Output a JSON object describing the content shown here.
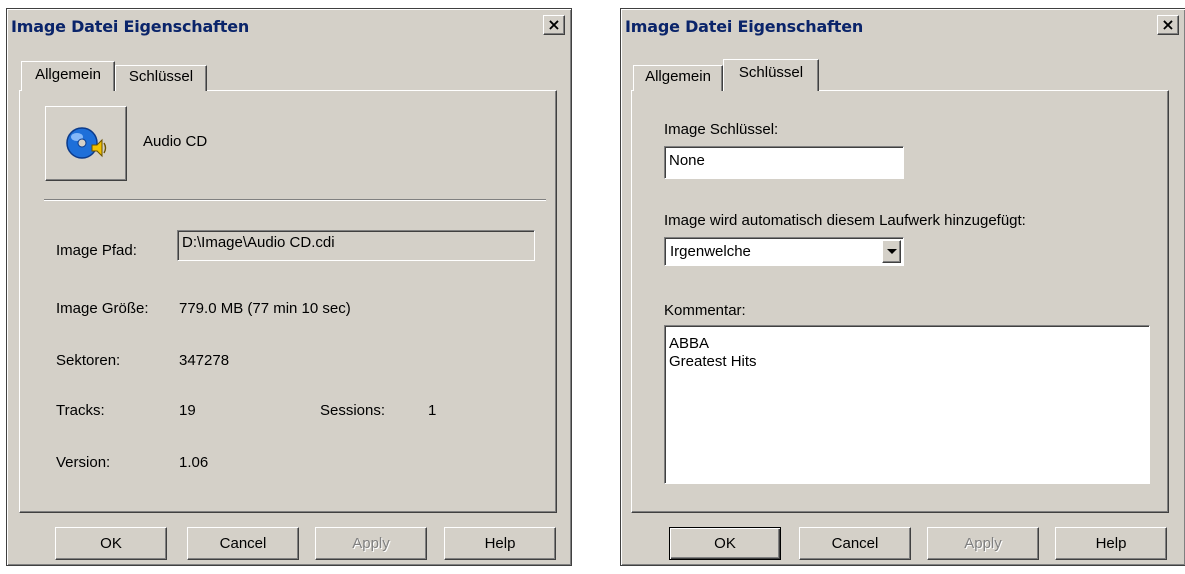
{
  "left_dialog": {
    "title": "Image Datei Eigenschaften",
    "close_glyph": "×",
    "tabs": [
      "Allgemein",
      "Schlüssel"
    ],
    "active_tab": "Allgemein",
    "icon": "audio-cd-icon",
    "image_type": "Audio CD",
    "path_label": "Image Pfad:",
    "path_value": "D:\\Image\\Audio CD.cdi",
    "size_label": "Image Größe:",
    "size_value": "779.0 MB (77 min 10 sec)",
    "sectors_label": "Sektoren:",
    "sectors_value": "347278",
    "tracks_label": "Tracks:",
    "tracks_value": "19",
    "sessions_label": "Sessions:",
    "sessions_value": "1",
    "version_label": "Version:",
    "version_value": "1.06",
    "buttons": {
      "ok": "OK",
      "cancel": "Cancel",
      "apply": "Apply",
      "help": "Help"
    }
  },
  "right_dialog": {
    "title": "Image Datei Eigenschaften",
    "close_glyph": "×",
    "tabs": [
      "Allgemein",
      "Schlüssel"
    ],
    "active_tab": "Schlüssel",
    "key_label": "Image Schlüssel:",
    "key_value": "None",
    "drive_label": "Image wird automatisch diesem Laufwerk hinzugefügt:",
    "drive_value": "Irgenwelche",
    "comment_label": "Kommentar:",
    "comment_value": "ABBA\nGreatest Hits",
    "buttons": {
      "ok": "OK",
      "cancel": "Cancel",
      "apply": "Apply",
      "help": "Help"
    }
  },
  "colors": {
    "title_text": "#0a246a",
    "face": "#d4d0c8",
    "icon_blue": "#1e6fd9",
    "icon_yellow": "#f2c200"
  }
}
